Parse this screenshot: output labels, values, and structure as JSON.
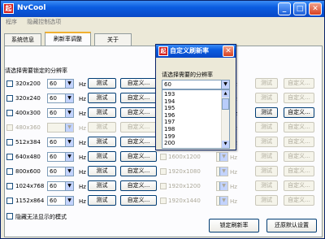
{
  "window": {
    "title": "NvCool",
    "app_icon_glyph": "起",
    "controls": {
      "minimize": "_",
      "maximize": "□",
      "close": "✕"
    }
  },
  "menu": [
    "程序",
    "隐藏控制选项"
  ],
  "tabs": [
    "系统信息",
    "刷新率调整",
    "关于"
  ],
  "prompt": "请选择需要锁定的分辨率",
  "hz": "Hz",
  "test_label": "测试",
  "custom_label": "自定义...",
  "left_rows": [
    {
      "res": "320x200",
      "rate": "60",
      "enabled": true
    },
    {
      "res": "320x240",
      "rate": "60",
      "enabled": true
    },
    {
      "res": "400x300",
      "rate": "60",
      "enabled": true
    },
    {
      "res": "480x360",
      "rate": "",
      "enabled": false
    },
    {
      "res": "512x384",
      "rate": "60",
      "enabled": true
    },
    {
      "res": "640x480",
      "rate": "60",
      "enabled": true
    },
    {
      "res": "800x600",
      "rate": "60",
      "enabled": true
    },
    {
      "res": "1024x768",
      "rate": "60",
      "enabled": true
    },
    {
      "res": "1152x864",
      "rate": "60",
      "enabled": true
    }
  ],
  "right_rows": [
    {
      "res": "",
      "enabled": false
    },
    {
      "res": "",
      "enabled": false
    },
    {
      "res": "",
      "enabled": true
    },
    {
      "res": "",
      "enabled": false
    },
    {
      "res": "",
      "enabled": false
    },
    {
      "res": "1600x1200",
      "enabled": false
    },
    {
      "res": "1920x1080",
      "enabled": false
    },
    {
      "res": "1920x1200",
      "enabled": false
    },
    {
      "res": "1920x1440",
      "enabled": false
    }
  ],
  "hide_label": "隐藏无法显示的模式",
  "buttons": {
    "lock": "锁定刷新率",
    "restore": "还原默认设置"
  },
  "dialog": {
    "title": "自定义刷新率",
    "icon_glyph": "起",
    "close": "✕",
    "prompt": "请选择需要的分辨率",
    "selected": "60",
    "options": [
      "193",
      "194",
      "195",
      "196",
      "197",
      "198",
      "199",
      "200"
    ]
  }
}
